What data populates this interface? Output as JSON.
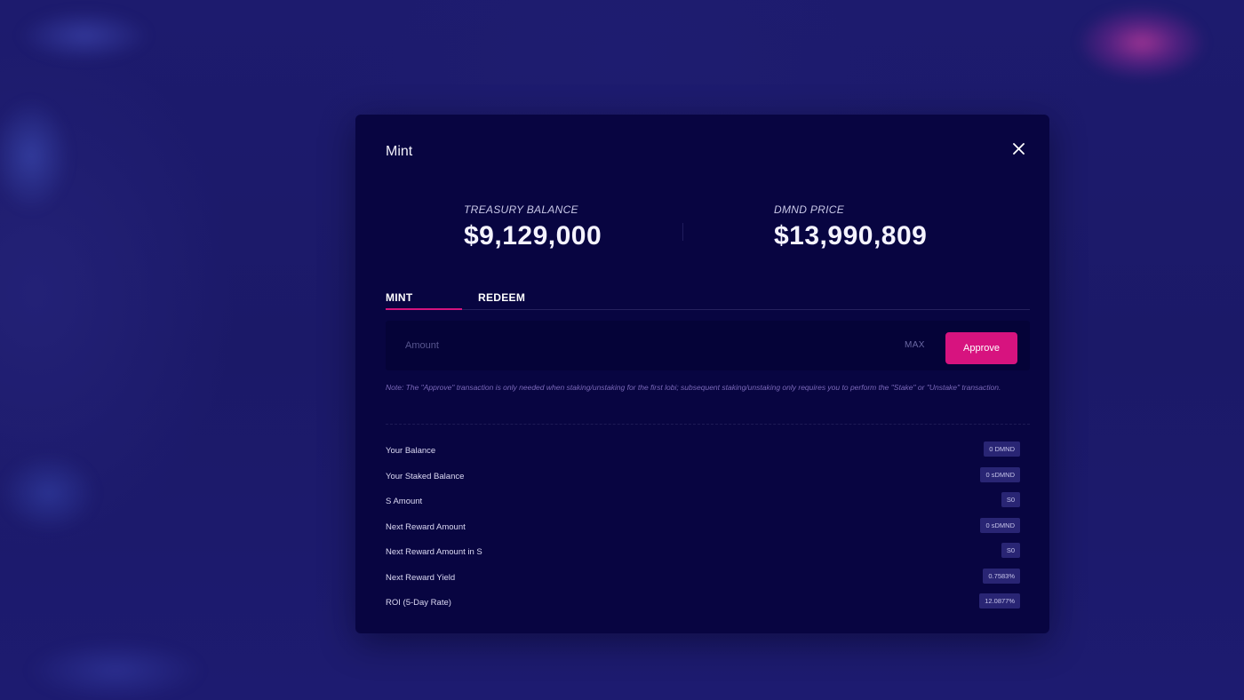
{
  "modal": {
    "title": "Mint",
    "close_icon": "close-icon"
  },
  "stats": {
    "treasury": {
      "label": "TREASURY BALANCE",
      "value": "$9,129,000"
    },
    "price": {
      "label": "DMND PRICE",
      "value": "$13,990,809"
    }
  },
  "tabs": [
    {
      "label": "MINT",
      "active": true
    },
    {
      "label": "REDEEM",
      "active": false
    }
  ],
  "form": {
    "amount_placeholder": "Amount",
    "amount_value": "",
    "max_label": "MAX",
    "approve_label": "Approve"
  },
  "note": "Note: The \"Approve\" transaction is only needed when staking/unstaking for the first lobi; subsequent staking/unstaking only requires you to perform the \"Stake\" or \"Unstake\" transaction.",
  "info": [
    {
      "label": "Your Balance",
      "value": "0 DMND"
    },
    {
      "label": "Your Staked Balance",
      "value": "0 sDMND"
    },
    {
      "label": "S Amount",
      "value": "S0"
    },
    {
      "label": "Next Reward Amount",
      "value": "0 sDMND"
    },
    {
      "label": "Next Reward Amount in S",
      "value": "S0"
    },
    {
      "label": "Next Reward Yield",
      "value": "0.7583%"
    },
    {
      "label": "ROI (5-Day Rate)",
      "value": "12.0877%"
    }
  ],
  "colors": {
    "background": "#1c1a6c",
    "modal": "#080541",
    "accent": "#d7137f",
    "badge": "#292574",
    "note": "#7a68b8"
  }
}
